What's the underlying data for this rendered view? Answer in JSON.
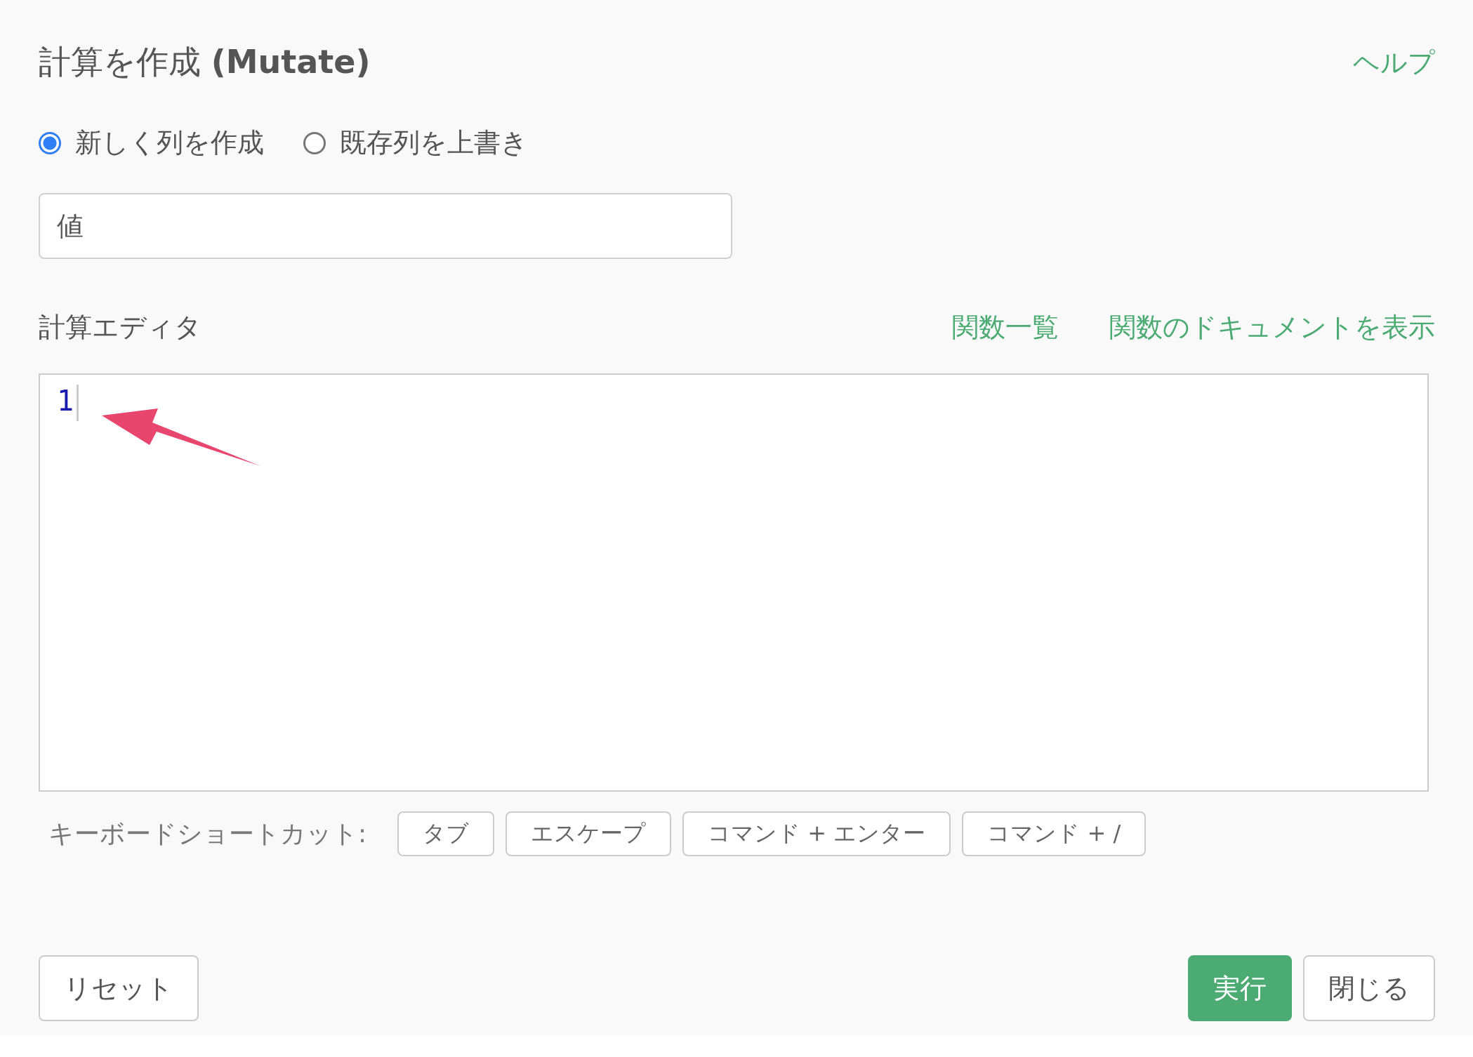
{
  "title": "計算を作成 **(Mutate)**",
  "help_link": "ヘルプ",
  "mode_options": [
    {
      "label": "新しく列を作成",
      "selected": true
    },
    {
      "label": "既存列を上書き",
      "selected": false
    }
  ],
  "column_name": {
    "value": "値"
  },
  "editor": {
    "label": "計算エディタ",
    "links": [
      "関数一覧",
      "関数のドキュメントを表示"
    ],
    "code": "1"
  },
  "shortcuts": {
    "label": "キーボードショートカット:",
    "keys": [
      "タブ",
      "エスケープ",
      "コマンド + エンター",
      "コマンド + /"
    ]
  },
  "buttons": [
    {
      "label": "リセット",
      "kind": "secondary"
    },
    {
      "label": "実行",
      "kind": "primary"
    },
    {
      "label": "閉じる",
      "kind": "secondary"
    }
  ]
}
